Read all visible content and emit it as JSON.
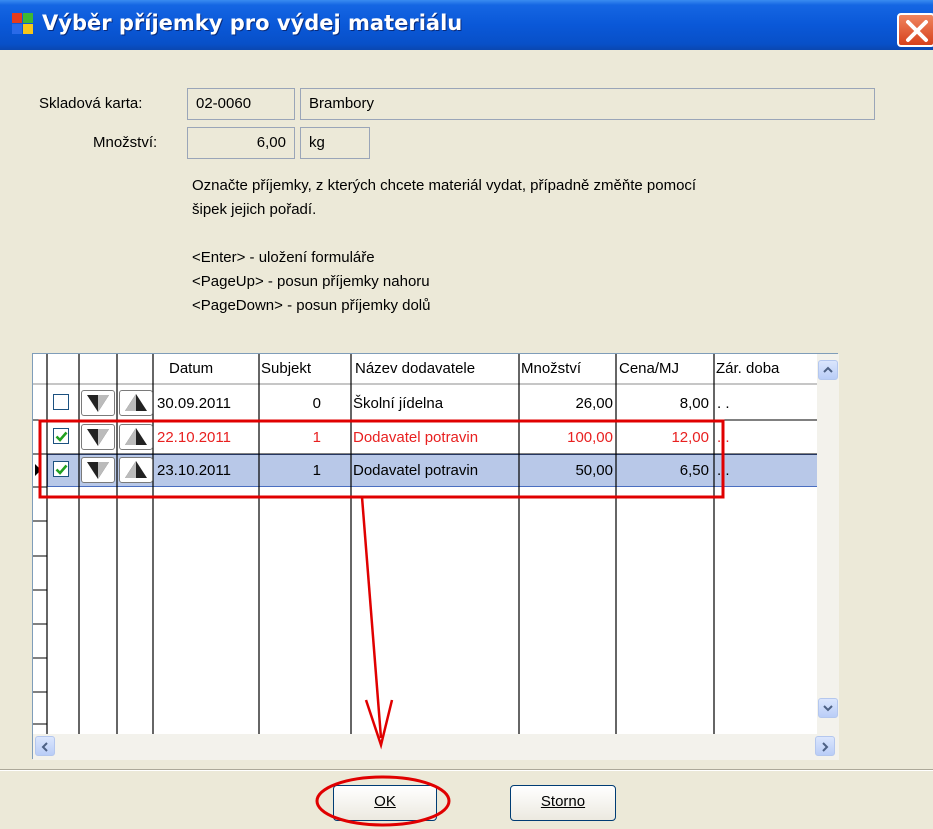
{
  "window": {
    "title": "Výběr příjemky pro výdej materiálu"
  },
  "form": {
    "stock_card_label": "Skladová karta:",
    "stock_card_code": "02-0060",
    "stock_card_name": "Brambory",
    "quantity_label": "Množství:",
    "quantity_value": "6,00",
    "quantity_unit": "kg"
  },
  "instructions": {
    "line1": "Označte příjemky, z kterých chcete materiál vydat, případně změňte pomocí",
    "line2": "šipek jejich pořadí.",
    "line3": "<Enter> - uložení formuláře",
    "line4": "<PageUp> - posun příjemky nahoru",
    "line5": "<PageDown> - posun příjemky dolů"
  },
  "grid": {
    "columns": [
      "Datum",
      "Subjekt",
      "Název dodavatele",
      "Množství",
      "Cena/MJ",
      "Zár. doba"
    ],
    "rows": [
      {
        "checked": false,
        "date": "30.09.2011",
        "subject": "0",
        "supplier": "Školní jídelna",
        "quantity": "26,00",
        "price": "8,00",
        "warranty": ". .",
        "highlight": "none"
      },
      {
        "checked": true,
        "date": "22.10.2011",
        "subject": "1",
        "supplier": "Dodavatel potravin",
        "quantity": "100,00",
        "price": "12,00",
        "warranty": ". .",
        "highlight": "red"
      },
      {
        "checked": true,
        "date": "23.10.2011",
        "subject": "1",
        "supplier": "Dodavatel potravin",
        "quantity": "50,00",
        "price": "6,50",
        "warranty": ". .",
        "highlight": "selected"
      }
    ]
  },
  "buttons": {
    "ok_label": "OK",
    "cancel_label": "Storno"
  },
  "colors": {
    "title_blue": "#0a58d8",
    "selection": "#b8c8e8",
    "annotation_red": "#e00000",
    "red_text": "#e82020"
  },
  "icons": {
    "row_down": "down-triangle-icon",
    "row_up": "up-triangle-icon",
    "checkbox": "checkmark-icon"
  }
}
